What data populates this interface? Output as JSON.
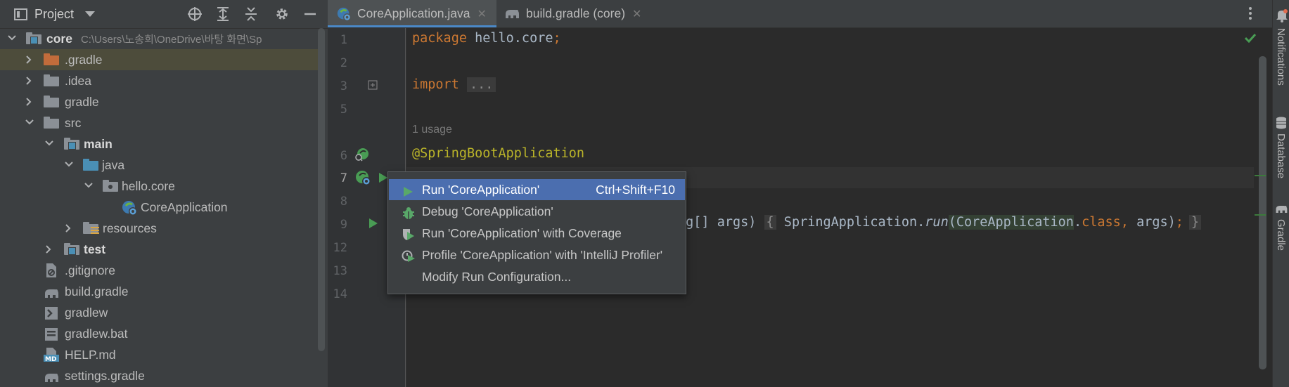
{
  "project_panel": {
    "title": "Project",
    "tree": [
      {
        "label": "core",
        "path": "C:\\Users\\노송희\\OneDrive\\바탕 화면\\Sp"
      },
      {
        "label": ".gradle"
      },
      {
        "label": ".idea"
      },
      {
        "label": "gradle"
      },
      {
        "label": "src"
      },
      {
        "label": "main"
      },
      {
        "label": "java"
      },
      {
        "label": "hello.core"
      },
      {
        "label": "CoreApplication"
      },
      {
        "label": "resources"
      },
      {
        "label": "test"
      },
      {
        "label": ".gitignore"
      },
      {
        "label": "build.gradle"
      },
      {
        "label": "gradlew"
      },
      {
        "label": "gradlew.bat"
      },
      {
        "label": "HELP.md"
      },
      {
        "label": "settings.gradle"
      }
    ]
  },
  "editor": {
    "tabs": [
      {
        "label": "CoreApplication.java"
      },
      {
        "label": "build.gradle (core)"
      }
    ],
    "line_numbers": [
      "1",
      "2",
      "3",
      "5",
      "6",
      "7",
      "8",
      "9",
      "12",
      "13",
      "14"
    ],
    "usage_hint": "1 usage",
    "code": {
      "package_kw": "package",
      "package_name": " hello.core",
      "semicolon": ";",
      "import_kw": "import",
      "import_fold": "...",
      "annotation": "@SpringBootApplication",
      "main_sig": "ng[] args) ",
      "brace_open": "{",
      "call_prefix": " SpringApplication.",
      "call_method": "run",
      "call_paren": "(",
      "call_class": "CoreApplication",
      "call_dot": ".",
      "call_class_kw": "class",
      "call_comma": ", ",
      "call_args": "args)",
      "call_semicolon": ";",
      "brace_close": "}"
    }
  },
  "context_menu": {
    "items": [
      {
        "label": "Run 'CoreApplication'",
        "shortcut": "Ctrl+Shift+F10"
      },
      {
        "label": "Debug 'CoreApplication'"
      },
      {
        "label": "Run 'CoreApplication' with Coverage"
      },
      {
        "label": "Profile 'CoreApplication' with 'IntelliJ Profiler'"
      },
      {
        "label": "Modify Run Configuration..."
      }
    ]
  },
  "right_strip": {
    "notifications": "Notifications",
    "database": "Database",
    "gradle": "Gradle"
  },
  "colors": {
    "accent": "#4b6eaf",
    "run_green": "#499c54",
    "keyword": "#cc7832",
    "annotation": "#bbb529"
  }
}
